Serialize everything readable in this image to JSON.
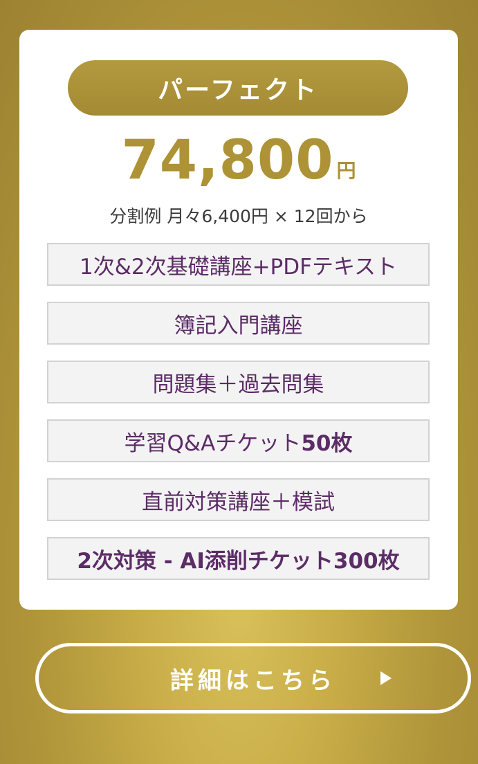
{
  "plan": {
    "name": "パーフェクト",
    "price": "74,800",
    "price_unit": "円",
    "installment": "分割例 月々6,400円 × 12回から"
  },
  "features": [
    {
      "text": "1次&2次基礎講座+PDFテキスト"
    },
    {
      "text": "簿記入門講座"
    },
    {
      "text": "問題集＋過去問集"
    },
    {
      "text_plain": "学習Q&Aチケット",
      "text_bold": "50枚"
    },
    {
      "text": "直前対策講座＋模試"
    },
    {
      "text": "2次対策 - AI添削チケット300枚"
    }
  ],
  "cta": {
    "label": "詳細はこちら",
    "arrow_icon": "play-arrow-icon"
  },
  "colors": {
    "gold": "#ad9236",
    "purple_text": "#5b2c66",
    "feature_bg": "#f4f3f4"
  }
}
